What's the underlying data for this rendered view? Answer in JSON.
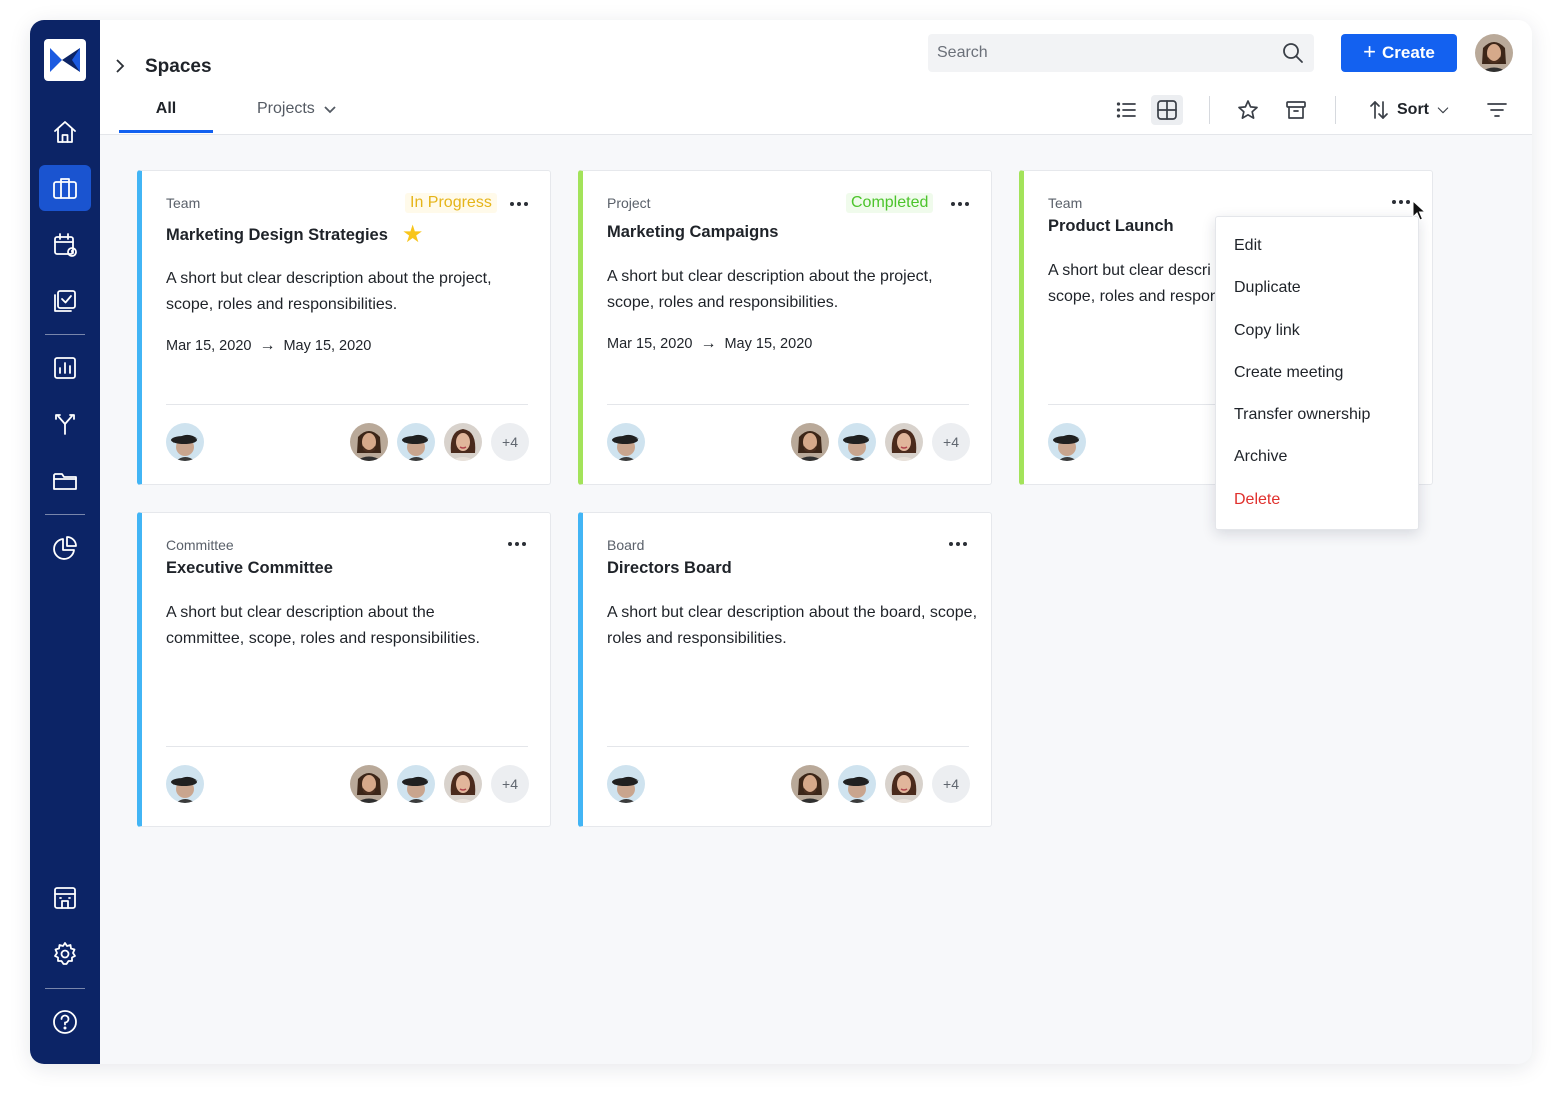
{
  "sidebar": {
    "logo_icon": "brand-logo-icon",
    "items": [
      {
        "icon": "home-icon"
      },
      {
        "icon": "briefcase-icon",
        "active": true
      },
      {
        "icon": "calendar-icon"
      },
      {
        "icon": "tasks-icon"
      },
      {
        "icon": "analytics-icon"
      },
      {
        "icon": "fork-icon"
      },
      {
        "icon": "folder-icon"
      },
      {
        "icon": "pie-chart-icon"
      },
      {
        "icon": "building-icon"
      },
      {
        "icon": "gear-icon"
      },
      {
        "icon": "help-icon"
      }
    ]
  },
  "header": {
    "title": "Spaces",
    "search_placeholder": "Search",
    "create_label": "Create",
    "tabs": [
      {
        "label": "All",
        "active": true
      },
      {
        "label": "Projects"
      }
    ],
    "sort_label": "Sort"
  },
  "colors": {
    "sidebar": "#0c2466",
    "accent": "#1361f0",
    "team_border": "#42b5f5",
    "project_border": "#a3e35a",
    "in_progress": "#e5b419",
    "completed": "#4cc42b",
    "danger": "#e0302d"
  },
  "cards": [
    {
      "type": "Team",
      "name": "Marketing Design Strategies",
      "status": "In Progress",
      "favorite": true,
      "description": "A short but clear description about the project, scope, roles and responsibilities.",
      "start_date": "Mar 15, 2020",
      "end_date": "May 15, 2020",
      "extra_members": "+4"
    },
    {
      "type": "Project",
      "name": "Marketing Campaigns",
      "status": "Completed",
      "description": "A short but clear description about the project, scope, roles and responsibilities.",
      "start_date": "Mar 15, 2020",
      "end_date": "May 15, 2020",
      "extra_members": "+4"
    },
    {
      "type": "Team",
      "name": "Product Launch",
      "description_line1": "A short but clear descri",
      "description_line2": "scope, roles and respon"
    },
    {
      "type": "Committee",
      "name": "Executive Committee",
      "description": "A short but clear description about the committee, scope, roles and responsibilities.",
      "extra_members": "+4"
    },
    {
      "type": "Board",
      "name": "Directors Board",
      "description": "A short but clear description about the board, scope, roles and responsibilities.",
      "extra_members": "+4"
    }
  ],
  "context_menu": {
    "items": [
      "Edit",
      "Duplicate",
      "Copy link",
      "Create meeting",
      "Transfer ownership",
      "Archive"
    ],
    "danger_item": "Delete"
  }
}
